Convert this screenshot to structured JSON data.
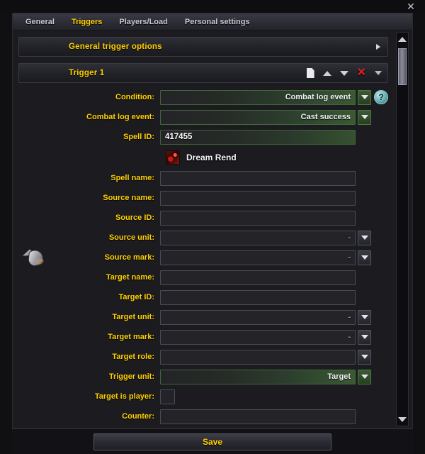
{
  "window": {
    "close_label": "✕"
  },
  "tabs": [
    {
      "label": "General",
      "active": false
    },
    {
      "label": "Triggers",
      "active": true
    },
    {
      "label": "Players/Load",
      "active": false
    },
    {
      "label": "Personal settings",
      "active": false
    }
  ],
  "sections": {
    "general_trigger_options": {
      "title": "General trigger options",
      "collapsed": true
    },
    "trigger_1": {
      "title": "Trigger 1",
      "icons": [
        "document-icon",
        "move-up-icon",
        "move-down-icon",
        "delete-icon",
        "collapse-icon"
      ]
    }
  },
  "fields": {
    "condition": {
      "label": "Condition:",
      "value": "Combat log  event",
      "help": "?"
    },
    "combat_log_event": {
      "label": "Combat log  event:",
      "value": "Cast success"
    },
    "spell_id": {
      "label": "Spell ID:",
      "value": "417455"
    },
    "spell_result": {
      "name": "Dream Rend",
      "icon": "spell-icon"
    },
    "spell_name": {
      "label": "Spell name:",
      "value": ""
    },
    "source_name": {
      "label": "Source name:",
      "value": ""
    },
    "source_id": {
      "label": "Source ID:",
      "value": ""
    },
    "source_unit": {
      "label": "Source unit:",
      "value": "-"
    },
    "source_mark": {
      "label": "Source mark:",
      "value": "-"
    },
    "target_name": {
      "label": "Target name:",
      "value": ""
    },
    "target_id": {
      "label": "Target ID:",
      "value": ""
    },
    "target_unit": {
      "label": "Target unit:",
      "value": "-"
    },
    "target_mark": {
      "label": "Target mark:",
      "value": "-"
    },
    "target_role": {
      "label": "Target role:",
      "value": ""
    },
    "trigger_unit": {
      "label": "Trigger unit:",
      "value": "Target"
    },
    "target_is_player": {
      "label": "Target is player:",
      "checked": false
    },
    "counter": {
      "label": "Counter:",
      "value": ""
    }
  },
  "footer": {
    "save_label": "Save"
  },
  "colors": {
    "accent_gold": "#ffd100",
    "active_green": "#35512f",
    "delete_red": "#e02020",
    "help_teal": "#5fa7ab"
  }
}
